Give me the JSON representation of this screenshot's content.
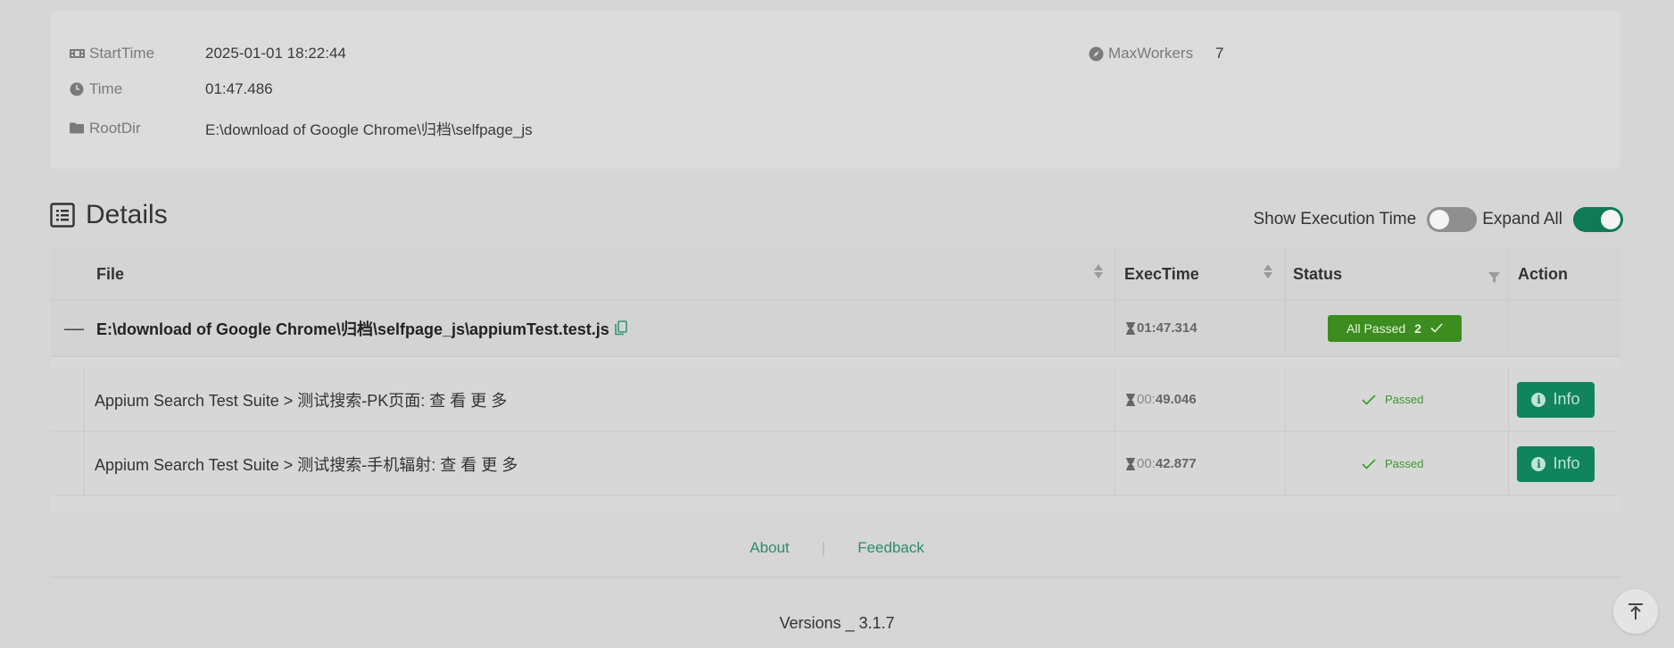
{
  "summary": {
    "start_time_label": "StartTime",
    "start_time_value": "2025-01-01 18:22:44",
    "time_label": "Time",
    "time_value": "01:47.486",
    "root_dir_label": "RootDir",
    "root_dir_value": "E:\\download of Google Chrome\\归档\\selfpage_js",
    "max_workers_label": "MaxWorkers",
    "max_workers_value": "7"
  },
  "details": {
    "title": "Details",
    "show_exec_time_label": "Show Execution Time",
    "show_exec_time_on": false,
    "expand_all_label": "Expand All",
    "expand_all_on": true
  },
  "table": {
    "columns": {
      "file": "File",
      "exec_time": "ExecTime",
      "status": "Status",
      "action": "Action"
    },
    "group": {
      "collapse_symbol": "—",
      "file_path": "E:\\download of Google Chrome\\归档\\selfpage_js\\appiumTest.test.js",
      "exec_time": "01:47.314",
      "status_label": "All Passed",
      "passed_count": "2"
    },
    "rows": [
      {
        "title": "Appium Search Test Suite > 测试搜索-PK页面: 查 看 更 多",
        "exec_time_light": "00:",
        "exec_time_bold": "49.046",
        "status": "Passed",
        "action": "Info"
      },
      {
        "title": "Appium Search Test Suite > 测试搜索-手机辐射: 查 看 更 多",
        "exec_time_light": "00:",
        "exec_time_bold": "42.877",
        "status": "Passed",
        "action": "Info"
      }
    ]
  },
  "footer": {
    "about": "About",
    "separator": "|",
    "feedback": "Feedback",
    "version": "Versions _ 3.1.7"
  },
  "colors": {
    "accent_green": "#10845c",
    "badge_green": "#3b8d1f",
    "passed_green": "#3a9a2a"
  }
}
